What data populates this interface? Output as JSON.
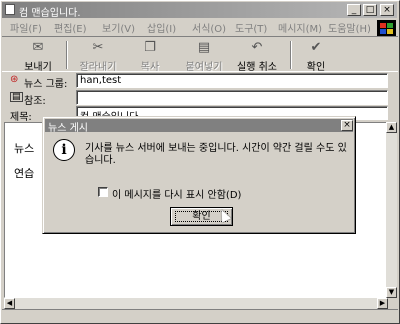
{
  "window": {
    "title": "컴 맨습입니다.",
    "min_label": "_",
    "max_label": "□",
    "close_label": "×"
  },
  "menu": [
    "파일(F)",
    "편집(E)",
    "보기(V)",
    "삽입(I)",
    "서식(O)",
    "도구(T)",
    "메시지(M)",
    "도움말(H)"
  ],
  "toolbar": {
    "send": "보내기",
    "cut": "잘라내기",
    "copy": "복사",
    "paste": "붙여넣기",
    "undo": "실행 취소",
    "check": "확인"
  },
  "header": {
    "newsgroups_label": "뉴스 그룹:",
    "newsgroups_value": "han,test",
    "cc_label": "참조:",
    "cc_value": "",
    "subject_label": "제목:",
    "subject_value": "컴 맨습입니다."
  },
  "body": {
    "line1": "뉴스",
    "line2": "연습"
  },
  "dialog": {
    "title": "뉴스 게시",
    "close_label": "×",
    "icon": "info-icon",
    "message": "기사를 뉴스 서버에 보내는 중입니다. 시간이 약간 걸릴 수도 있습니다.",
    "checkbox_label": "이 메시지를 다시 표시 안함(D)",
    "checkbox_checked": false,
    "ok_label": "확인"
  },
  "scroll": {
    "up": "▲",
    "down": "▼",
    "left": "◀",
    "right": "▶"
  }
}
